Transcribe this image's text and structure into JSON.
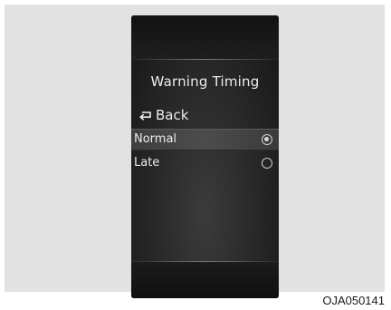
{
  "screen": {
    "title": "Warning Timing",
    "back_label": "Back",
    "back_icon": "return-arrow-icon",
    "options": [
      {
        "label": "Normal",
        "selected": true
      },
      {
        "label": "Late",
        "selected": false
      }
    ]
  },
  "figure_code": "OJA050141",
  "colors": {
    "screen_bg": "#262626",
    "text": "#ececec",
    "highlight": "#474747",
    "frame_bg": "#e2e2e2"
  }
}
